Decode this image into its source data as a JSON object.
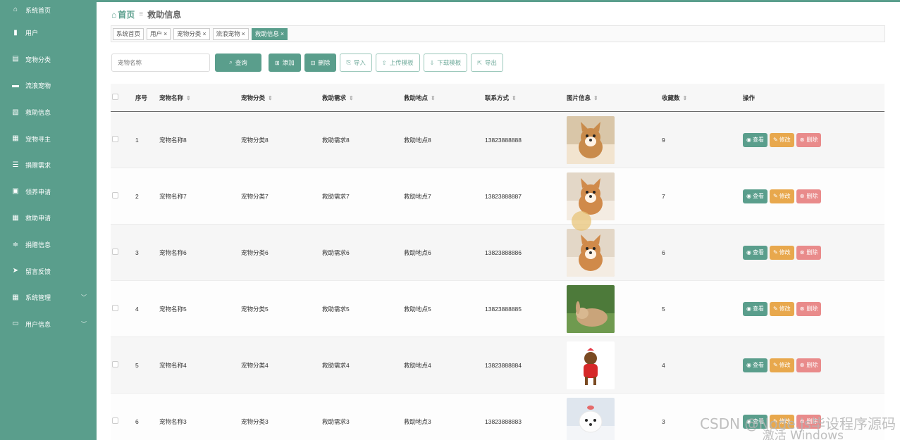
{
  "sidebar": {
    "items": [
      {
        "label": "系统首页",
        "icon": "home-icon",
        "glyph": "⌂"
      },
      {
        "label": "用户",
        "icon": "bar-chart-icon",
        "glyph": "▮"
      },
      {
        "label": "宠物分类",
        "icon": "clipboard-icon",
        "glyph": "▤"
      },
      {
        "label": "流浪宠物",
        "icon": "briefcase-icon",
        "glyph": "▬"
      },
      {
        "label": "救助信息",
        "icon": "chart-icon",
        "glyph": "▧"
      },
      {
        "label": "宠物寻主",
        "icon": "grid-icon",
        "glyph": "▦"
      },
      {
        "label": "捐赠需求",
        "icon": "list-icon",
        "glyph": "☰"
      },
      {
        "label": "领养申请",
        "icon": "checklist-icon",
        "glyph": "▣"
      },
      {
        "label": "救助申请",
        "icon": "grid-icon",
        "glyph": "▦"
      },
      {
        "label": "捐赠信息",
        "icon": "sliders-icon",
        "glyph": "≑"
      },
      {
        "label": "留言反馈",
        "icon": "send-icon",
        "glyph": "➤"
      },
      {
        "label": "系统管理",
        "icon": "grid-icon",
        "glyph": "▦",
        "chevron": "﹀"
      },
      {
        "label": "用户信息",
        "icon": "window-icon",
        "glyph": "▭",
        "chevron": "﹀"
      }
    ]
  },
  "breadcrumb": {
    "home": "首页",
    "separator": "≡",
    "current": "救助信息"
  },
  "tags": [
    {
      "label": "系统首页",
      "closable": ""
    },
    {
      "label": "用户",
      "closable": "×"
    },
    {
      "label": "宠物分类",
      "closable": "×"
    },
    {
      "label": "流浪宠物",
      "closable": "×"
    },
    {
      "label": "救助信息",
      "closable": "×",
      "active": true
    }
  ],
  "toolbar": {
    "search_placeholder": "宠物名称",
    "query": "查询",
    "add": "添加",
    "delete": "删除",
    "import": "导入",
    "upload_template": "上传模板",
    "download_template": "下载模板",
    "export": "导出"
  },
  "table": {
    "headers": {
      "index": "序号",
      "name": "宠物名称",
      "category": "宠物分类",
      "need": "救助需求",
      "location": "救助地点",
      "contact": "联系方式",
      "image": "图片信息",
      "favorites": "收藏数",
      "ops": "操作"
    },
    "ops": {
      "view": "查看",
      "edit": "修改",
      "delete": "删除"
    },
    "rows": [
      {
        "index": "1",
        "name": "宠物名称8",
        "category": "宠物分类8",
        "need": "救助需求8",
        "location": "救助地点8",
        "contact": "13823888888",
        "image": "pomeranian",
        "favorites": "9"
      },
      {
        "index": "2",
        "name": "宠物名称7",
        "category": "宠物分类7",
        "need": "救助需求7",
        "location": "救助地点7",
        "contact": "13823888887",
        "image": "corgi",
        "favorites": "7"
      },
      {
        "index": "3",
        "name": "宠物名称6",
        "category": "宠物分类6",
        "need": "救助需求6",
        "location": "救助地点6",
        "contact": "13823888886",
        "image": "corgi",
        "favorites": "6"
      },
      {
        "index": "4",
        "name": "宠物名称5",
        "category": "宠物分类5",
        "need": "救助需求5",
        "location": "救助地点5",
        "contact": "13823888885",
        "image": "rabbit",
        "favorites": "5"
      },
      {
        "index": "5",
        "name": "宠物名称4",
        "category": "宠物分类4",
        "need": "救助需求4",
        "location": "救助地点4",
        "contact": "13823888884",
        "image": "yorkie",
        "favorites": "4"
      },
      {
        "index": "6",
        "name": "宠物名称3",
        "category": "宠物分类3",
        "need": "救助需求3",
        "location": "救助地点3",
        "contact": "13823888883",
        "image": "maltese",
        "favorites": "3"
      }
    ]
  },
  "watermark": {
    "csdn": "CSDN @Node.js毕设程序源码",
    "windows": "激活 Windows"
  },
  "colors": {
    "accent": "#5a9e8c",
    "edit": "#e8a84d",
    "delete": "#e98b8b"
  }
}
